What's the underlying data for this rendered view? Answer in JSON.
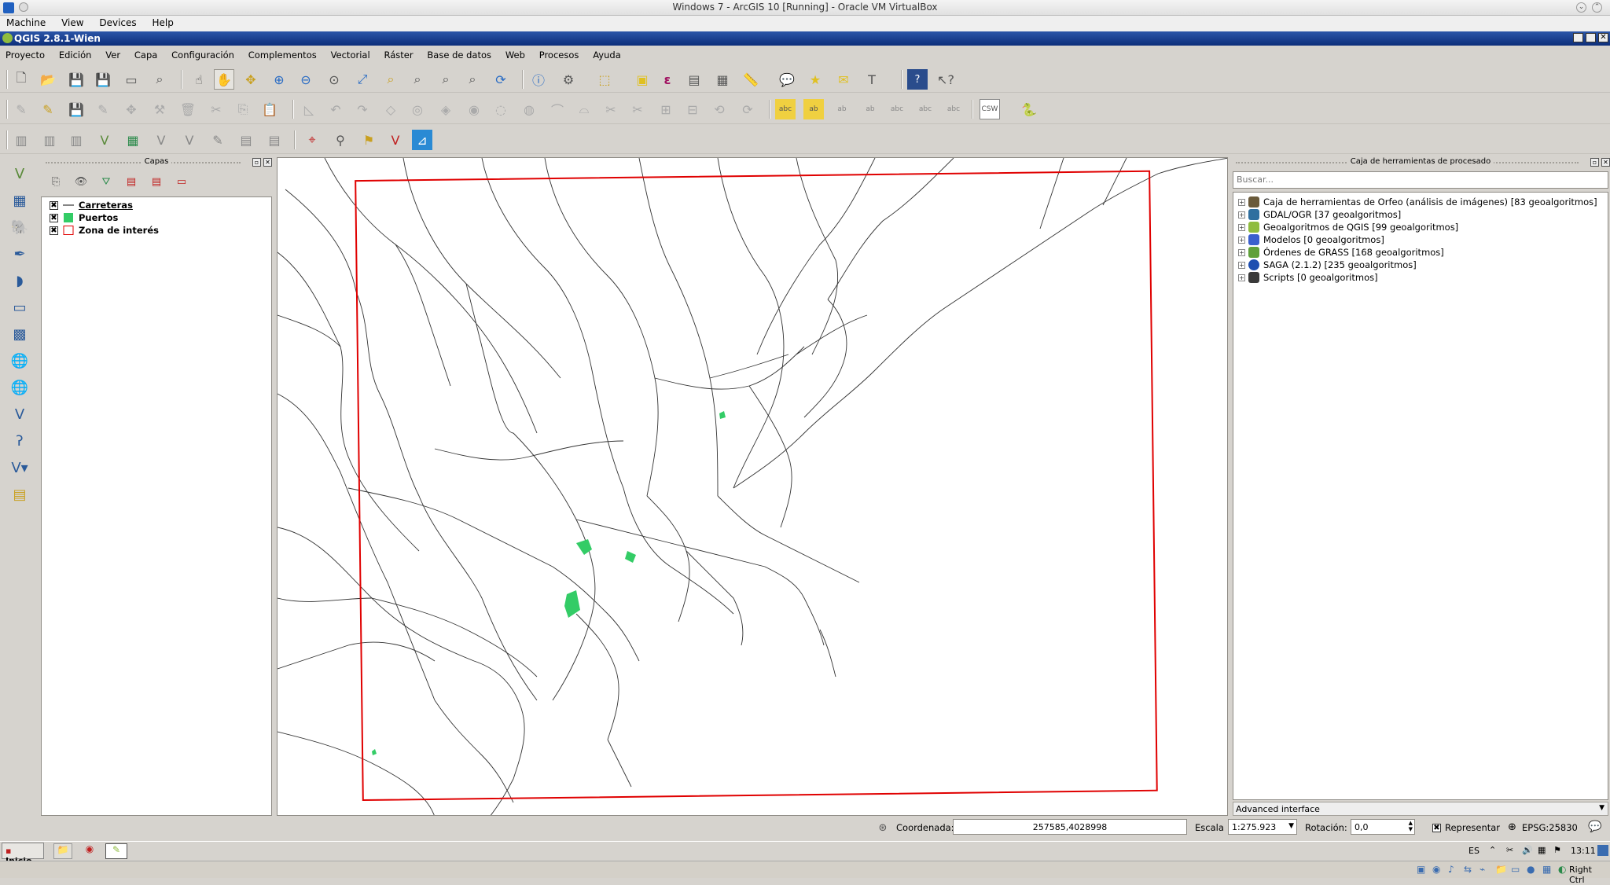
{
  "vbox": {
    "title": "Windows 7 - ArcGIS 10 [Running] - Oracle VM VirtualBox",
    "menu": [
      "Machine",
      "View",
      "Devices",
      "Help"
    ],
    "host_key": "Right Ctrl"
  },
  "qgis": {
    "title": "QGIS 2.8.1-Wien",
    "menu": [
      "Proyecto",
      "Edición",
      "Ver",
      "Capa",
      "Configuración",
      "Complementos",
      "Vectorial",
      "Ráster",
      "Base de datos",
      "Web",
      "Procesos",
      "Ayuda"
    ]
  },
  "layers_panel": {
    "title": "Capas",
    "layers": [
      {
        "name": "Carreteras",
        "checked": "✖",
        "symbol": "line"
      },
      {
        "name": "Puertos",
        "checked": "✖",
        "symbol": "fill-green"
      },
      {
        "name": "Zona de interés",
        "checked": "✖",
        "symbol": "outline-red"
      }
    ]
  },
  "processing_panel": {
    "title": "Caja de herramientas de procesado",
    "search_placeholder": "Buscar...",
    "items": [
      {
        "label": "Caja de herramientas de Orfeo (análisis de imágenes) [83 geoalgoritmos]",
        "icon": "orfeo-icon",
        "color": "#6a5a3a"
      },
      {
        "label": "GDAL/OGR [37 geoalgoritmos]",
        "icon": "gdal-icon",
        "color": "#2f6f9f"
      },
      {
        "label": "Geoalgoritmos de QGIS [99 geoalgoritmos]",
        "icon": "qgis-icon",
        "color": "#8fbc3f"
      },
      {
        "label": "Modelos [0 geoalgoritmos]",
        "icon": "models-icon",
        "color": "#3a5fcd"
      },
      {
        "label": "Órdenes de GRASS [168 geoalgoritmos]",
        "icon": "grass-icon",
        "color": "#5fa03a"
      },
      {
        "label": "SAGA (2.1.2) [235 geoalgoritmos]",
        "icon": "saga-icon",
        "color": "#1f4fb0"
      },
      {
        "label": "Scripts [0 geoalgoritmos]",
        "icon": "scripts-icon",
        "color": "#3a3a3a"
      }
    ],
    "advanced_label": "Advanced interface"
  },
  "status": {
    "coord_label": "Coordenada:",
    "coord_value": "257585,4028998",
    "scale_label": "Escala",
    "scale_value": "1:275.923",
    "rotation_label": "Rotación:",
    "rotation_value": "0,0",
    "render_label": "Representar",
    "epsg": "EPSG:25830"
  },
  "taskbar": {
    "start_label": "Inicio",
    "lang": "ES",
    "time": "13:11"
  },
  "colors": {
    "road": "#333333",
    "port": "#33cc66",
    "interest_zone": "#e00000"
  }
}
